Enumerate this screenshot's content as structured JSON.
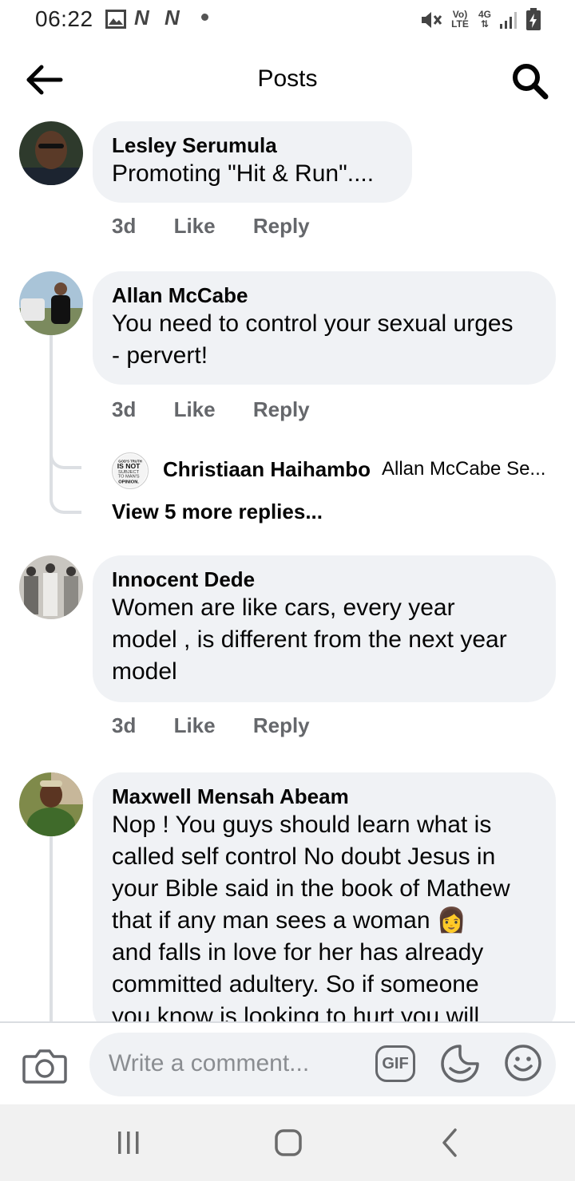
{
  "status_bar": {
    "time": "06:22",
    "notification_icons": [
      "image-icon",
      "n-icon",
      "n-icon"
    ],
    "volte_label": "Vo)\nLTE",
    "network_label": "4G"
  },
  "header": {
    "title": "Posts"
  },
  "comments": [
    {
      "author": "Lesley Serumula",
      "text_lines": [
        "Promoting \"Hit & Run\"...."
      ],
      "time": "3d",
      "like_label": "Like",
      "reply_label": "Reply"
    },
    {
      "author": "Allan McCabe",
      "text_lines": [
        "You need to control your sexual urges",
        "- pervert!"
      ],
      "time": "3d",
      "like_label": "Like",
      "reply_label": "Reply",
      "reply_preview": {
        "author": "Christiaan Haihambo",
        "text": "Allan McCabe Se...",
        "avatar_lines": [
          "GOD'S TRUTH",
          "IS NOT",
          "SUBJECT",
          "TO MAN'S",
          "OPINION."
        ]
      },
      "view_more": "View 5 more replies..."
    },
    {
      "author": "Innocent Dede",
      "text_lines": [
        "Women are like cars, every year",
        "model , is different from the next year",
        "model"
      ],
      "time": "3d",
      "like_label": "Like",
      "reply_label": "Reply"
    },
    {
      "author": "Maxwell Mensah Abeam",
      "text_lines": [
        "Nop ! You guys should learn what is",
        "called self control No doubt Jesus in",
        "your Bible said in the book of Mathew",
        "that if any man sees a woman 👩",
        "and falls in love for her has already",
        "committed adultery.  So if someone",
        "you know is looking to hurt you will"
      ]
    }
  ],
  "composer": {
    "placeholder": "Write a comment...",
    "gif_label": "GIF"
  },
  "colors": {
    "bubble": "#f0f2f5",
    "meta_text": "#65676b",
    "nav_bar": "#f1f1f1"
  }
}
